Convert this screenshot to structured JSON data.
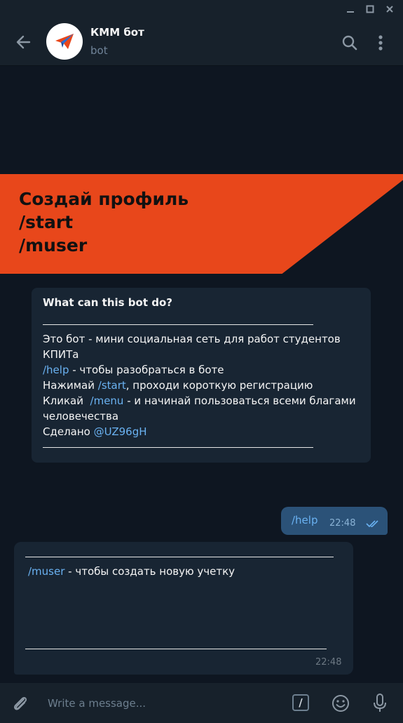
{
  "window": {
    "controls": [
      "minimize-icon",
      "maximize-icon",
      "close-icon"
    ]
  },
  "header": {
    "title": "КММ бот",
    "subtitle": "bot",
    "icons": [
      "back-arrow-icon",
      "paper-plane-icon",
      "search-icon",
      "more-vertical-icon"
    ]
  },
  "banner": {
    "lines": [
      "Создай профиль",
      "/start",
      "/muser"
    ],
    "color": "#e8471b"
  },
  "info_card": {
    "title": "What can this bot do?",
    "line1": "Это бот - мини социальная сеть для работ студентов КПИТа",
    "help_cmd": "/help",
    "help_text": " - чтобы разобраться в боте",
    "start_prefix": "Нажимай ",
    "start_cmd": "/start",
    "start_text": ", проходи короткую регистрацию",
    "menu_prefix": "Кликай  ",
    "menu_cmd": "/menu",
    "menu_text": " - и начинай пользоваться всеми благами человечества",
    "made_prefix": "Сделано ",
    "made_handle": "@UZ96gH"
  },
  "messages": {
    "outgoing": {
      "text": "/help",
      "time": "22:48",
      "status_icon": "double-check-icon"
    },
    "incoming": {
      "cmd": "/muser",
      "text": " - чтобы создать новую учетку",
      "time": "22:48"
    }
  },
  "composer": {
    "placeholder": "Write a message...",
    "command_label": "/",
    "icons": [
      "attach-icon",
      "command-icon",
      "emoji-icon",
      "mic-icon"
    ]
  },
  "colors": {
    "background": "#0e1621",
    "panel": "#17212b",
    "bubble_in": "#182533",
    "bubble_out": "#2b5278",
    "link": "#6ab2f2"
  }
}
